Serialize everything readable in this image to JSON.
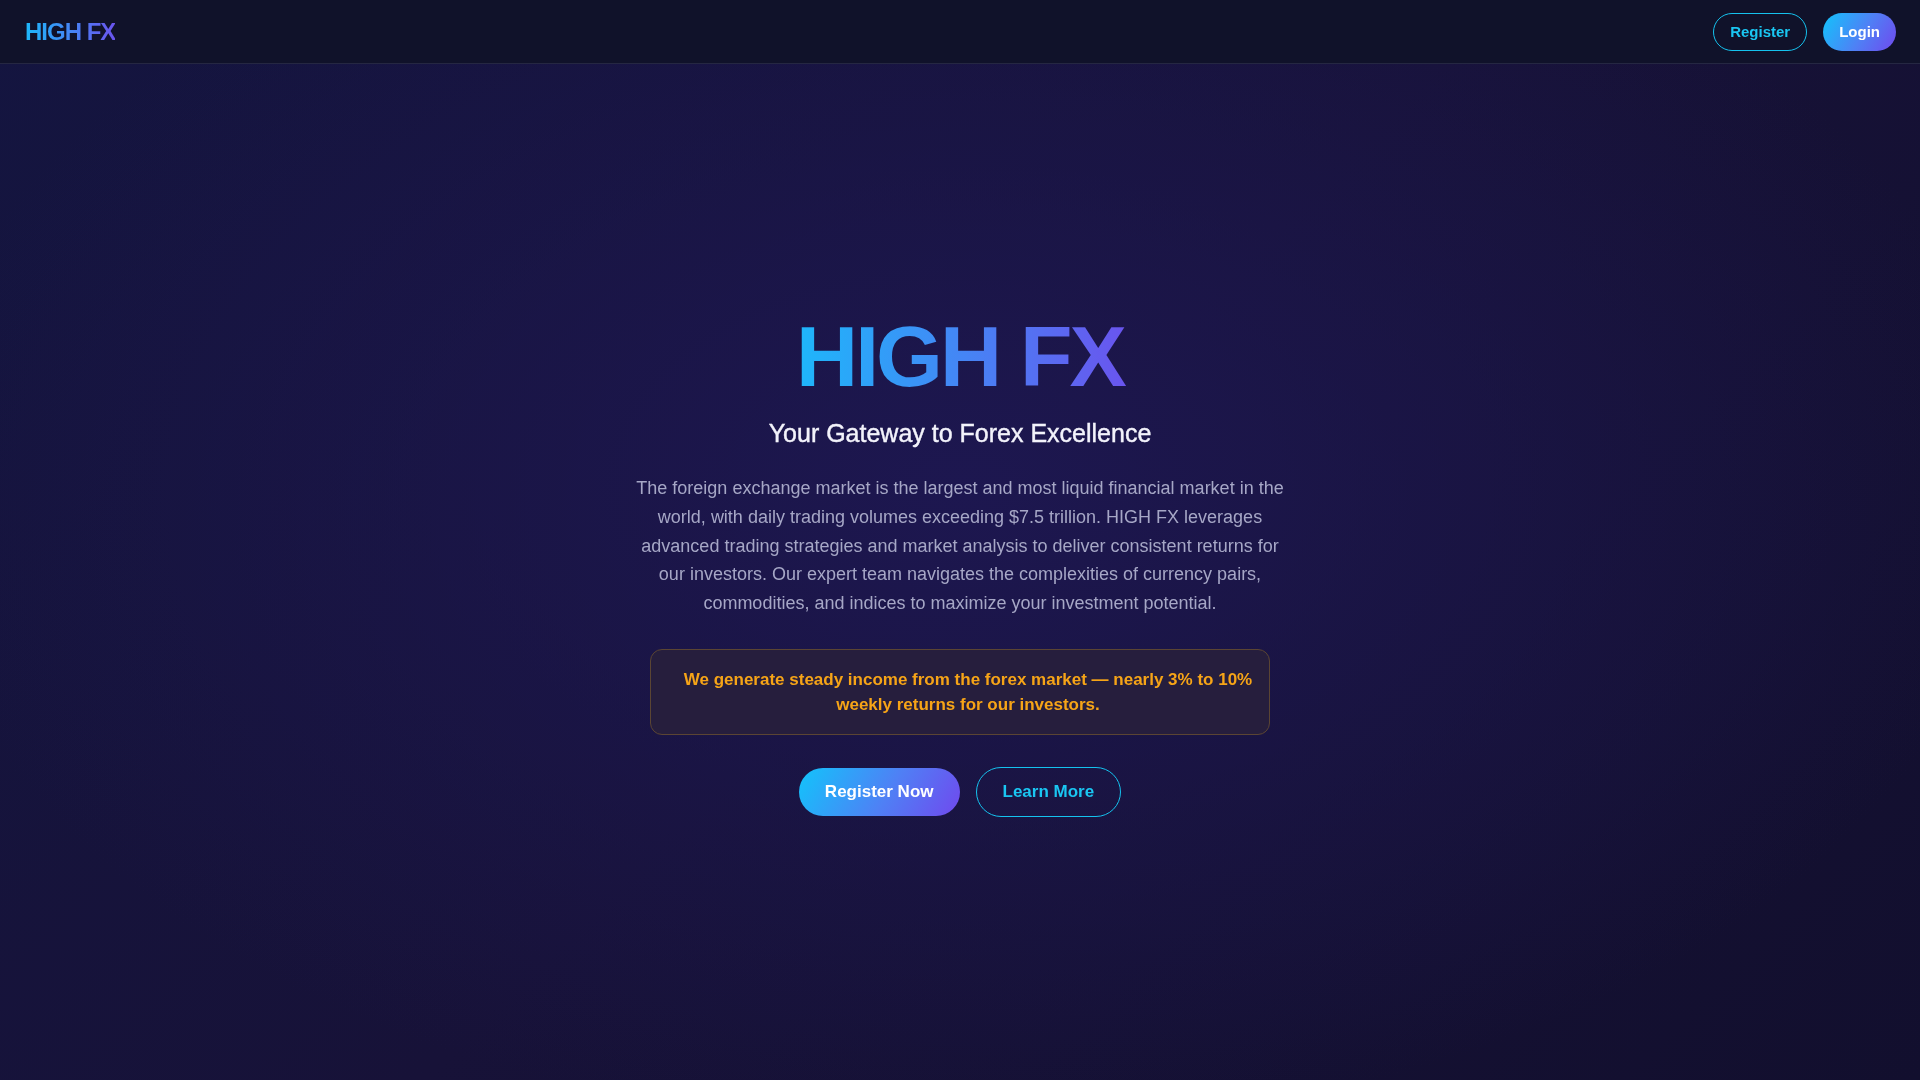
{
  "header": {
    "logo": "HIGH FX",
    "buttons": [
      {
        "label": "Register",
        "kind": "outline"
      },
      {
        "label": "Login",
        "kind": "gradient"
      }
    ]
  },
  "hero": {
    "title": "HIGH FX",
    "subtitle": "Your Gateway to Forex Excellence",
    "description": "The foreign exchange market is the largest and most liquid financial market in the world, with daily trading volumes exceeding $7.5 trillion. HIGH FX leverages advanced trading strategies and market analysis to deliver consistent returns for our investors. Our expert team navigates the complexities of currency pairs, commodities, and indices to maximize your investment potential.",
    "highlight": "We generate steady income from the forex market — nearly 3% to 10% weekly returns for our investors.",
    "actions": [
      {
        "label": "Register Now",
        "kind": "gradient"
      },
      {
        "label": "Learn More",
        "kind": "outline"
      }
    ]
  }
}
